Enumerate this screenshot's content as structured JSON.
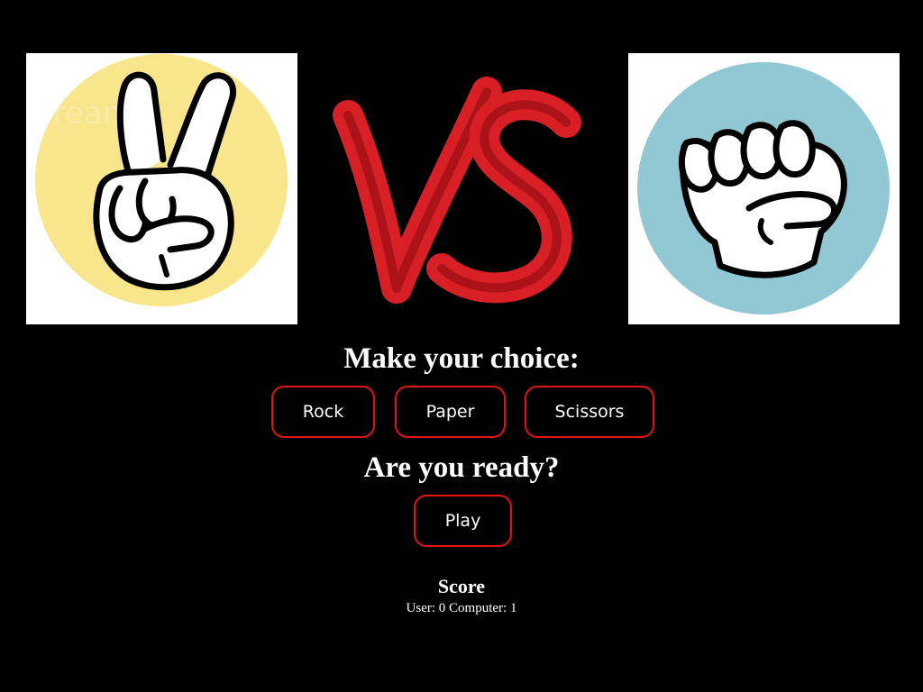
{
  "user_choice": {
    "gesture": "scissors",
    "icon": "peace-hand-icon",
    "circle_color": "#f8e58c"
  },
  "computer_choice": {
    "gesture": "rock",
    "icon": "fist-icon",
    "circle_color": "#92c8d4"
  },
  "vs_graphic": {
    "icon": "vs-brush-icon",
    "color": "#d81f26"
  },
  "prompt": {
    "choice_heading": "Make your choice:",
    "ready_heading": "Are you ready?"
  },
  "choices": {
    "rock_label": "Rock",
    "paper_label": "Paper",
    "scissors_label": "Scissors"
  },
  "play": {
    "label": "Play"
  },
  "score": {
    "title": "Score",
    "summary": "User: 0 Computer: 1"
  },
  "colors": {
    "background": "#000000",
    "button_border": "#e11414",
    "text": "#ffffff"
  }
}
